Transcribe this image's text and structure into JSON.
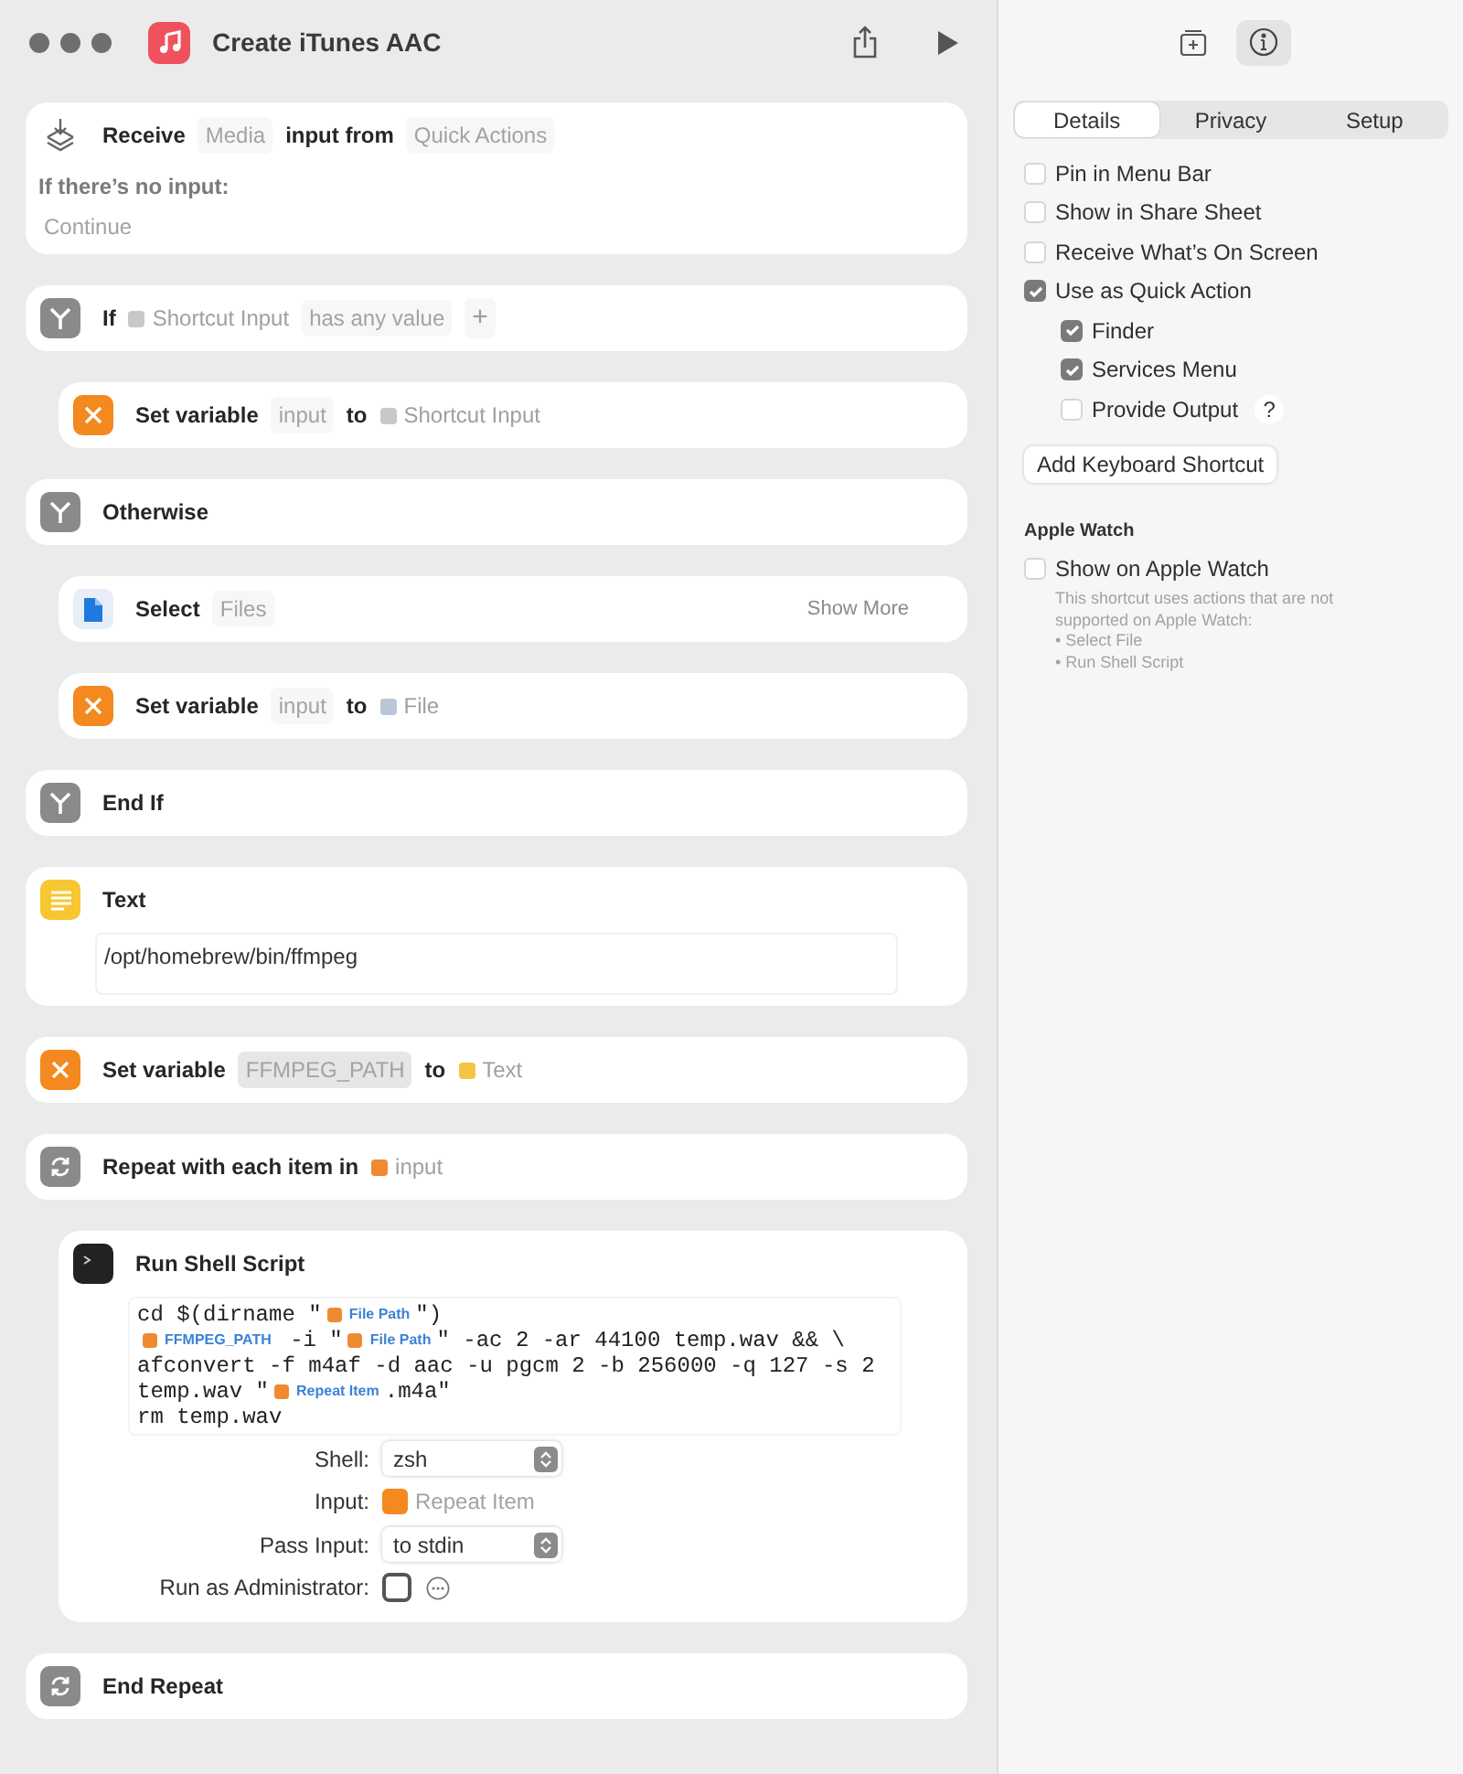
{
  "window": {
    "title": "Create iTunes AAC"
  },
  "actions": [
    {
      "kind": "receive",
      "tokens": [
        {
          "kind": "word",
          "text": "Receive"
        },
        {
          "kind": "param",
          "text": "Media"
        },
        {
          "kind": "word",
          "text": "input from"
        },
        {
          "kind": "param",
          "text": "Quick Actions"
        }
      ],
      "fallback_label": "If there’s no input:",
      "fallback_value": "Continue"
    },
    {
      "kind": "branch",
      "tokens": [
        {
          "kind": "word",
          "text": "If"
        },
        {
          "kind": "var",
          "text": "Shortcut Input",
          "color": "#c8c8c8"
        },
        {
          "kind": "param",
          "text": "has any value"
        },
        {
          "kind": "add",
          "text": "+"
        }
      ],
      "children": [
        {
          "kind": "variable",
          "tokens": [
            {
              "kind": "word",
              "text": "Set variable"
            },
            {
              "kind": "param",
              "text": "input"
            },
            {
              "kind": "word",
              "text": "to"
            },
            {
              "kind": "var",
              "text": "Shortcut Input",
              "color": "#c8c8c8"
            }
          ]
        }
      ]
    },
    {
      "kind": "branch",
      "tokens": [
        {
          "kind": "word",
          "text": "Otherwise"
        }
      ],
      "children": [
        {
          "kind": "file",
          "tokens": [
            {
              "kind": "word",
              "text": "Select"
            },
            {
              "kind": "param",
              "text": "Files"
            }
          ],
          "more": "Show More"
        },
        {
          "kind": "variable",
          "tokens": [
            {
              "kind": "word",
              "text": "Set variable"
            },
            {
              "kind": "param",
              "text": "input"
            },
            {
              "kind": "word",
              "text": "to"
            },
            {
              "kind": "var",
              "text": "File",
              "color": "#b9c6d8"
            }
          ]
        }
      ]
    },
    {
      "kind": "branch",
      "tokens": [
        {
          "kind": "word",
          "text": "End If"
        }
      ]
    },
    {
      "kind": "text",
      "tokens": [
        {
          "kind": "word",
          "text": "Text"
        }
      ],
      "body": "/opt/homebrew/bin/ffmpeg"
    },
    {
      "kind": "variable",
      "tokens": [
        {
          "kind": "word",
          "text": "Set variable"
        },
        {
          "kind": "param",
          "text": "FFMPEG_PATH",
          "filled": true
        },
        {
          "kind": "word",
          "text": "to"
        },
        {
          "kind": "var",
          "text": "Text",
          "color": "#f5c542"
        }
      ]
    },
    {
      "kind": "repeat",
      "tokens": [
        {
          "kind": "word",
          "text": "Repeat with each item in"
        },
        {
          "kind": "var",
          "text": "input",
          "color": "#f08a30"
        }
      ],
      "children": [
        {
          "kind": "terminal",
          "tokens": [
            {
              "kind": "word",
              "text": "Run Shell Script"
            }
          ],
          "script": [
            [
              {
                "kind": "code",
                "text": "cd $(dirname \""
              },
              {
                "kind": "var",
                "text": "File Path"
              },
              {
                "kind": "code",
                "text": "\")"
              }
            ],
            [
              {
                "kind": "var",
                "text": "FFMPEG_PATH"
              },
              {
                "kind": "code",
                "text": " -i \""
              },
              {
                "kind": "var",
                "text": "File Path"
              },
              {
                "kind": "code",
                "text": "\" -ac 2 -ar 44100 temp.wav && \\"
              }
            ],
            [
              {
                "kind": "code",
                "text": "afconvert -f m4af -d aac -u pgcm 2 -b 256000 -q 127 -s 2"
              }
            ],
            [
              {
                "kind": "code",
                "text": "temp.wav \""
              },
              {
                "kind": "var",
                "text": "Repeat Item"
              },
              {
                "kind": "code",
                "text": ".m4a\""
              }
            ],
            [
              {
                "kind": "code",
                "text": "rm temp.wav"
              }
            ]
          ],
          "options": [
            {
              "kind": "popup",
              "label": "Shell:",
              "value": "zsh"
            },
            {
              "kind": "var",
              "label": "Input:",
              "value": "Repeat Item"
            },
            {
              "kind": "popup",
              "label": "Pass Input:",
              "value": "to stdin"
            },
            {
              "kind": "checkbox",
              "label": "Run as Administrator:",
              "checked": false
            }
          ]
        }
      ]
    },
    {
      "kind": "repeat",
      "tokens": [
        {
          "kind": "word",
          "text": "End Repeat"
        }
      ]
    }
  ],
  "inspector": {
    "tabs": [
      {
        "label": "Details",
        "selected": true
      },
      {
        "label": "Privacy",
        "selected": false
      },
      {
        "label": "Setup",
        "selected": false
      }
    ],
    "options": [
      {
        "label": "Pin in Menu Bar",
        "checked": false
      },
      {
        "label": "Show in Share Sheet",
        "checked": false
      },
      {
        "label": "Receive What’s On Screen",
        "checked": false
      },
      {
        "label": "Use as Quick Action",
        "checked": true,
        "children": [
          {
            "label": "Finder",
            "checked": true
          },
          {
            "label": "Services Menu",
            "checked": true
          },
          {
            "label": "Provide Output",
            "checked": false,
            "help": "?"
          }
        ]
      }
    ],
    "button": "Add Keyboard Shortcut",
    "watch": {
      "heading": "Apple Watch",
      "label": "Show on Apple Watch",
      "checked": false,
      "note": "This shortcut uses actions that are not supported on Apple Watch:",
      "items": [
        "• Select File",
        "• Run Shell Script"
      ]
    }
  }
}
